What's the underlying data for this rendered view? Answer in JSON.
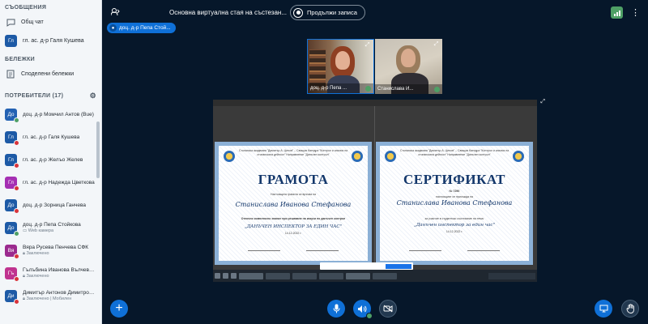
{
  "sidebar": {
    "messages_title": "СЪОБЩЕНИЯ",
    "public_chat": "Общ чат",
    "private_chat": {
      "initials": "Гл",
      "name": "гл. ас. д-р Галя Кушева"
    },
    "notes_title": "БЕЛЕЖКИ",
    "shared_notes": "Споделени бележки",
    "users_title": "ПОТРЕБИТЕЛИ (17)",
    "users": [
      {
        "initials": "До",
        "name": "доц. д-р Момчил Антов (Bue)",
        "sub": "",
        "color": "#2362b3"
      },
      {
        "initials": "Гл",
        "name": "гл. ас. д-р Галя Кушева",
        "sub": "",
        "color": "#1d5aa6"
      },
      {
        "initials": "Гл",
        "name": "гл. ас. д-р Желъо Желев",
        "sub": "",
        "color": "#1d5aa6"
      },
      {
        "initials": "Гл",
        "name": "гл. ас. д-р Надежда Цветкова",
        "sub": "",
        "color": "#a52fb3"
      },
      {
        "initials": "До",
        "name": "доц. д-р Зорница Ганчева",
        "sub": "",
        "color": "#1d5aa6"
      },
      {
        "initials": "До",
        "name": "доц. д-р Пепа Стойкова",
        "sub": "Web камера",
        "color": "#1d5aa6"
      },
      {
        "initials": "Вя",
        "name": "Вяра Русева Пенчева СФК",
        "sub": "Заключено",
        "color": "#9b2a8e"
      },
      {
        "initials": "Гъ",
        "name": "Гълъбина Иванова Вълчева ...",
        "sub": "Заключено",
        "color": "#c0338f"
      },
      {
        "initials": "Ди",
        "name": "Димитър Антонов Димитров ...",
        "sub": "Заключено | Мобилен",
        "color": "#1d5aa6"
      }
    ]
  },
  "header": {
    "title": "Основна виртуална стая на състезан...",
    "recording_label": "Продължи записа",
    "presenter": "доц. д-р Пепа Стой..."
  },
  "webcams": [
    {
      "name": "доц. д-р Пепа ..."
    },
    {
      "name": "Станислава И..."
    }
  ],
  "presentation": {
    "cert_left": {
      "header": "Стопанска академия \"Димитър А. Ценов\" – Свищов Катедра \"Контрол и анализ на стопанската дейност\" Направление \"Данъчен контрол\"",
      "title": "ГРАМОТА",
      "line1": "Настоящата грамота се връчва на",
      "name": "Станислава Иванова Стефанова",
      "line2": "Отлично комплексно знание при решаване на казуси по данъчен контрол",
      "topic": "„ДАНЪЧЕН ИНСПЕКТОР ЗА ЕДИН ЧАС\"",
      "date": "14.12.2022 г."
    },
    "cert_right": {
      "header": "Стопанска академия \"Димитър А. Ценов\" – Свищов Катедра \"Контрол и анализ на стопанската дейност\" Направление \"Данъчен контрол\"",
      "title": "СЕРТИФИКАТ",
      "number": "№ 7290",
      "line1": "настоящият се присъжда на",
      "name": "Станислава Иванова Стефанова",
      "line2": "за участие в студентско състезание на тема:",
      "topic": "„Данъчен инспектор за един час\"",
      "date": "14.12.2022 г."
    }
  }
}
